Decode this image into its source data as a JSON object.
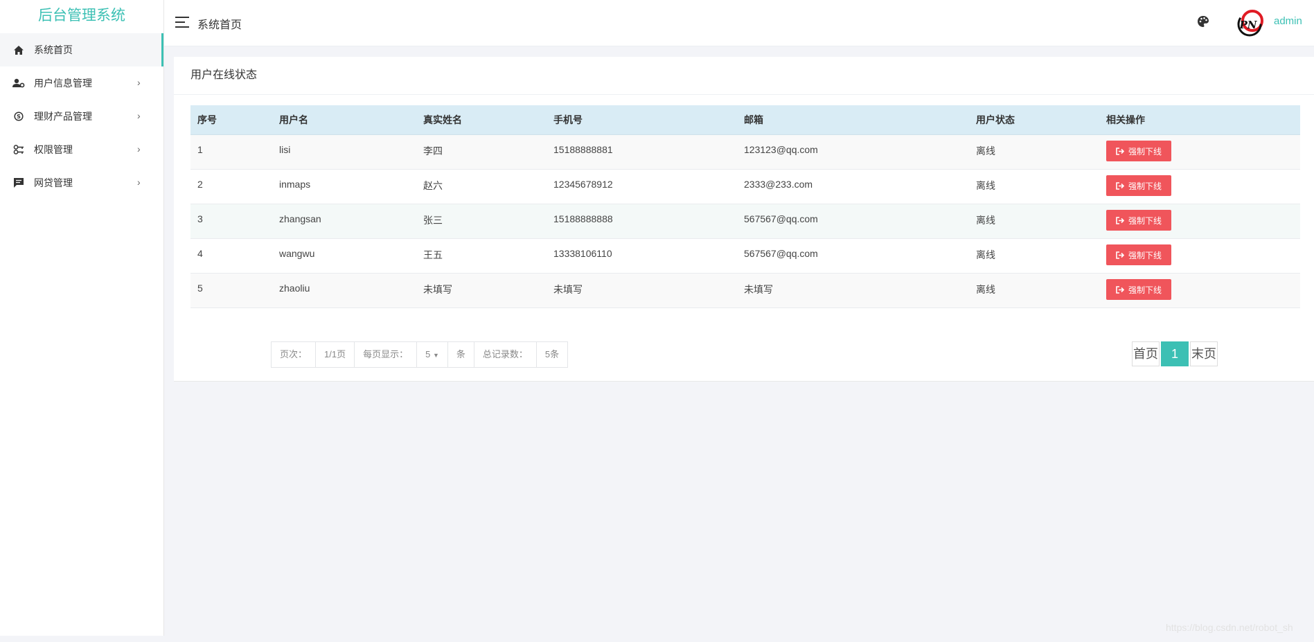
{
  "sidebar": {
    "brand": "后台管理系统",
    "items": [
      {
        "label": "系统首页",
        "icon": "home-icon"
      },
      {
        "label": "用户信息管理",
        "icon": "user-gear-icon"
      },
      {
        "label": "理财产品管理",
        "icon": "skype-icon"
      },
      {
        "label": "权限管理",
        "icon": "keys-icon"
      },
      {
        "label": "网贷管理",
        "icon": "chat-icon"
      }
    ],
    "chevron": "›"
  },
  "header": {
    "breadcrumb": "系统首页",
    "user": "admin",
    "avatar_text": "PN"
  },
  "card": {
    "title": "用户在线状态",
    "columns": [
      "序号",
      "用户名",
      "真实姓名",
      "手机号",
      "邮箱",
      "用户状态",
      "相关操作"
    ],
    "rows": [
      {
        "id": "1",
        "username": "lisi",
        "realname": "李四",
        "phone": "15188888881",
        "email": "123123@qq.com",
        "status": "离线",
        "action": "强制下线"
      },
      {
        "id": "2",
        "username": "inmaps",
        "realname": "赵六",
        "phone": "12345678912",
        "email": "2333@233.com",
        "status": "离线",
        "action": "强制下线"
      },
      {
        "id": "3",
        "username": "zhangsan",
        "realname": "张三",
        "phone": "15188888888",
        "email": "567567@qq.com",
        "status": "离线",
        "action": "强制下线"
      },
      {
        "id": "4",
        "username": "wangwu",
        "realname": "王五",
        "phone": "13338106110",
        "email": "567567@qq.com",
        "status": "离线",
        "action": "强制下线"
      },
      {
        "id": "5",
        "username": "zhaoliu",
        "realname": "未填写",
        "phone": "未填写",
        "email": "未填写",
        "status": "离线",
        "action": "强制下线"
      }
    ]
  },
  "pagination": {
    "page_label": "页次：",
    "page_value": "1/1页",
    "per_page_label": "每页显示：",
    "per_page_value": "5",
    "per_page_unit": "条",
    "total_label": "总记录数：",
    "total_value": "5条",
    "first": "首页",
    "current": "1",
    "last": "末页"
  },
  "watermark": "https://blog.csdn.net/robot_sh",
  "colors": {
    "accent": "#3cc0b4",
    "danger": "#f0555b",
    "header_bg": "#d9ecf5"
  }
}
